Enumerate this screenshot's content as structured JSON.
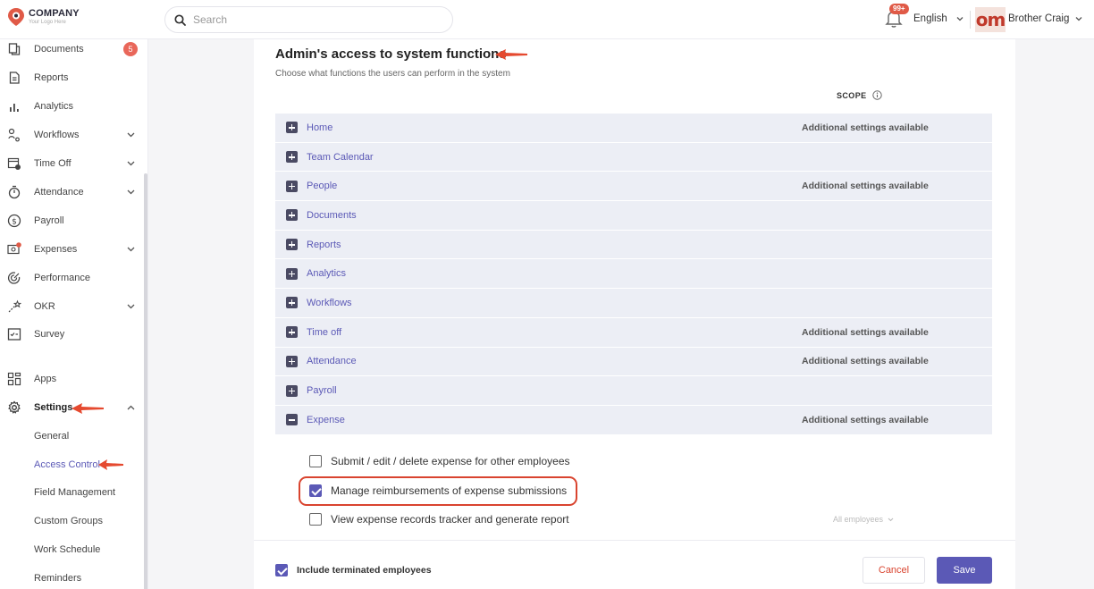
{
  "brand": {
    "name": "COMPANY",
    "tagline": "Your Logo Here"
  },
  "search": {
    "placeholder": "Search"
  },
  "notifications": {
    "badge": "99+"
  },
  "language": {
    "label": "English"
  },
  "user": {
    "name": "Brother Craig",
    "avatar_text": "om"
  },
  "sidebar": {
    "items": [
      {
        "label": "Documents",
        "icon": "documents-icon",
        "badge": "5"
      },
      {
        "label": "Reports",
        "icon": "reports-icon"
      },
      {
        "label": "Analytics",
        "icon": "analytics-icon"
      },
      {
        "label": "Workflows",
        "icon": "workflows-icon",
        "expandable": true
      },
      {
        "label": "Time Off",
        "icon": "time-off-icon",
        "expandable": true
      },
      {
        "label": "Attendance",
        "icon": "attendance-icon",
        "expandable": true
      },
      {
        "label": "Payroll",
        "icon": "payroll-icon"
      },
      {
        "label": "Expenses",
        "icon": "expenses-icon",
        "expandable": true
      },
      {
        "label": "Performance",
        "icon": "performance-icon"
      },
      {
        "label": "OKR",
        "icon": "okr-icon",
        "expandable": true
      },
      {
        "label": "Survey",
        "icon": "survey-icon"
      },
      {
        "label": "Apps",
        "icon": "apps-icon"
      },
      {
        "label": "Settings",
        "icon": "settings-icon",
        "expanded": true,
        "active": true
      }
    ],
    "settings_sub": [
      {
        "label": "General"
      },
      {
        "label": "Access Control",
        "active": true
      },
      {
        "label": "Field Management"
      },
      {
        "label": "Custom Groups"
      },
      {
        "label": "Work Schedule"
      },
      {
        "label": "Reminders"
      }
    ]
  },
  "main": {
    "title": "Admin's access to system functions",
    "subtitle": "Choose what functions the users can perform in the system",
    "scope_header": "SCOPE",
    "modules": [
      {
        "label": "Home",
        "extra": "Additional settings available",
        "expanded": false
      },
      {
        "label": "Team Calendar",
        "extra": "",
        "expanded": false
      },
      {
        "label": "People",
        "extra": "Additional settings available",
        "expanded": false
      },
      {
        "label": "Documents",
        "extra": "",
        "expanded": false
      },
      {
        "label": "Reports",
        "extra": "",
        "expanded": false
      },
      {
        "label": "Analytics",
        "extra": "",
        "expanded": false
      },
      {
        "label": "Workflows",
        "extra": "",
        "expanded": false
      },
      {
        "label": "Time off",
        "extra": "Additional settings available",
        "expanded": false
      },
      {
        "label": "Attendance",
        "extra": "Additional settings available",
        "expanded": false
      },
      {
        "label": "Payroll",
        "extra": "",
        "expanded": false
      },
      {
        "label": "Expense",
        "extra": "Additional settings available",
        "expanded": true
      }
    ],
    "expense_permissions": [
      {
        "label": "Submit / edit / delete expense for other employees",
        "checked": false
      },
      {
        "label": "Manage reimbursements of expense submissions",
        "checked": true
      },
      {
        "label": "View expense records tracker and generate report",
        "checked": false,
        "scope": "All employees"
      }
    ],
    "include_terminated": {
      "label": "Include terminated employees",
      "checked": true
    },
    "cancel_label": "Cancel",
    "save_label": "Save"
  },
  "colors": {
    "accent": "#5b59b6",
    "danger": "#d9442f",
    "row_bg": "#eceef5"
  }
}
